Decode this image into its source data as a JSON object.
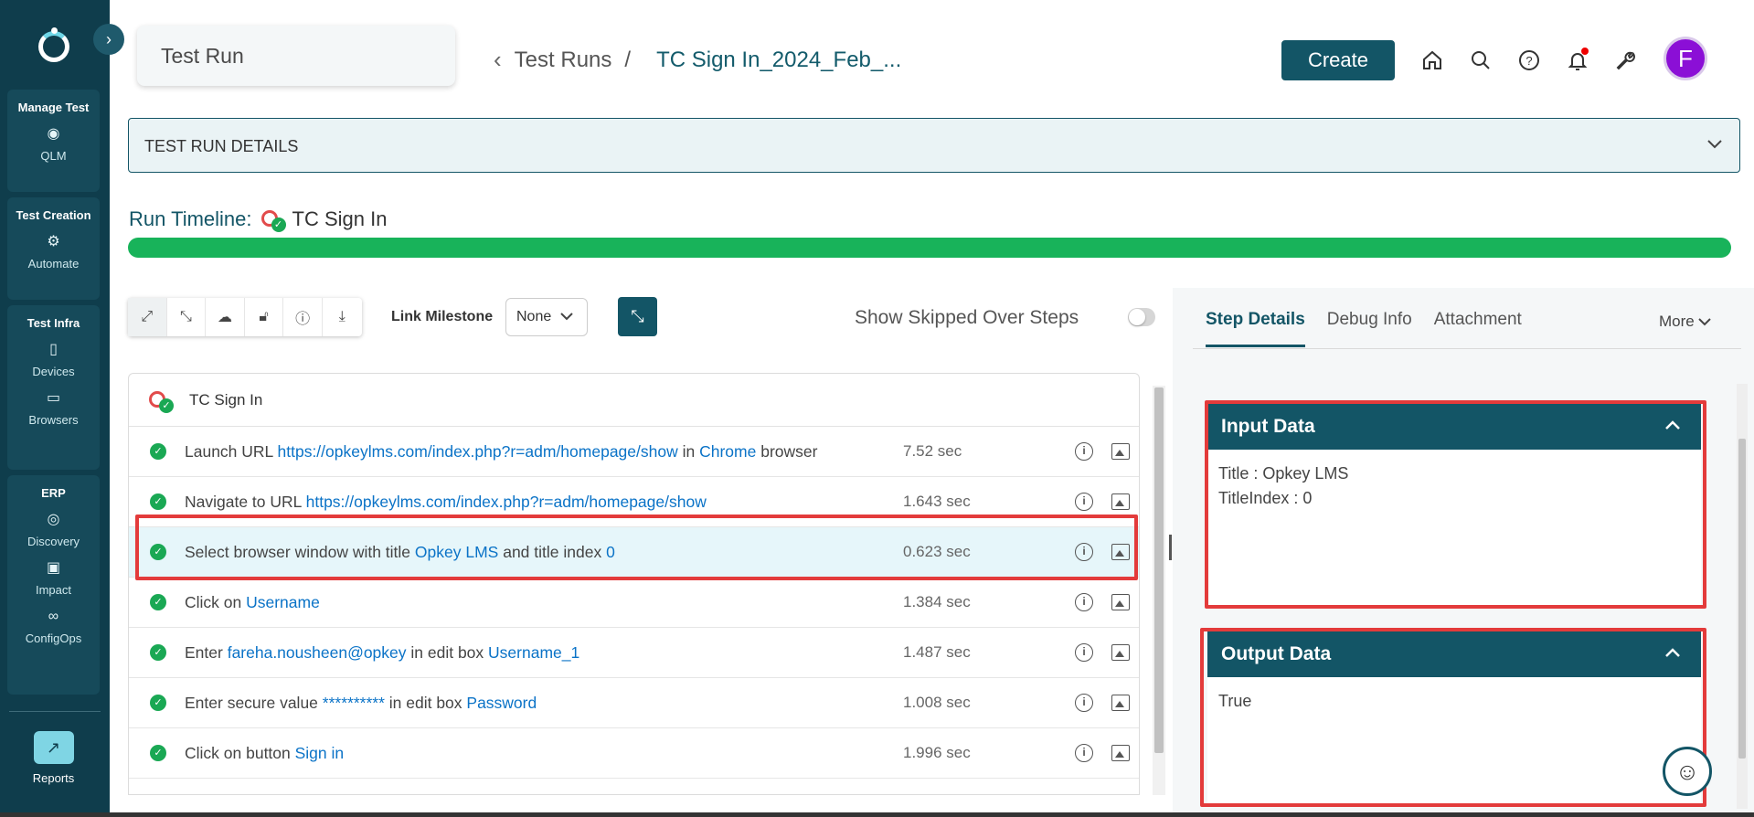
{
  "sidebar": {
    "groups": [
      {
        "title": "Manage Test",
        "items": [
          {
            "label": "QLM",
            "icon": "target-icon"
          }
        ]
      },
      {
        "title": "Test Creation",
        "items": [
          {
            "label": "Automate",
            "icon": "gears-icon"
          }
        ]
      },
      {
        "title": "Test Infra",
        "items": [
          {
            "label": "Devices",
            "icon": "mobile-icon"
          },
          {
            "label": "Browsers",
            "icon": "monitor-icon"
          }
        ]
      },
      {
        "title": "ERP",
        "items": [
          {
            "label": "Discovery",
            "icon": "compass-icon"
          },
          {
            "label": "Impact",
            "icon": "impact-icon"
          },
          {
            "label": "ConfigOps",
            "icon": "link-icon"
          }
        ]
      }
    ],
    "reports_label": "Reports"
  },
  "header": {
    "page_title": "Test Run",
    "breadcrumb_parent": "Test Runs",
    "breadcrumb_separator": "/",
    "breadcrumb_current": "TC Sign In_2024_Feb_...",
    "create_label": "Create",
    "avatar_initial": "F"
  },
  "details": {
    "title": "TEST RUN DETAILS"
  },
  "timeline": {
    "label": "Run Timeline:",
    "test_name": "TC Sign In",
    "progress": 1.0,
    "color": "#18b35a"
  },
  "toolbar": {
    "milestone_label": "Link Milestone",
    "milestone_value": "None",
    "skipped_label": "Show Skipped Over Steps"
  },
  "steps": {
    "header": "TC Sign In",
    "rows": [
      {
        "parts": [
          "Launch URL ",
          "https://opkeylms.com/index.php?r=adm/homepage/show",
          " in ",
          "Chrome",
          " browser"
        ],
        "duration": "7.52 sec"
      },
      {
        "parts": [
          "Navigate to URL ",
          "https://opkeylms.com/index.php?r=adm/homepage/show",
          "",
          "",
          ""
        ],
        "duration": "1.643 sec"
      },
      {
        "parts": [
          "Select browser window with title ",
          "Opkey LMS",
          " and title index ",
          "0",
          ""
        ],
        "duration": "0.623 sec"
      },
      {
        "parts": [
          "Click on ",
          "Username",
          "",
          "",
          ""
        ],
        "duration": "1.384 sec"
      },
      {
        "parts": [
          "Enter ",
          "fareha.nousheen@opkey",
          " in edit box ",
          "Username_1",
          ""
        ],
        "duration": "1.487 sec"
      },
      {
        "parts": [
          "Enter secure value ",
          "**********",
          " in edit box ",
          "Password",
          ""
        ],
        "duration": "1.008 sec"
      },
      {
        "parts": [
          "Click on button ",
          "Sign in",
          "",
          "",
          ""
        ],
        "duration": "1.996 sec"
      }
    ]
  },
  "right_panel": {
    "tabs": [
      "Step Details",
      "Debug Info",
      "Attachment"
    ],
    "more_label": "More",
    "input_title": "Input Data",
    "input_lines": [
      "Title : Opkey LMS",
      "TitleIndex : 0"
    ],
    "output_title": "Output Data",
    "output_lines": [
      "True"
    ]
  }
}
